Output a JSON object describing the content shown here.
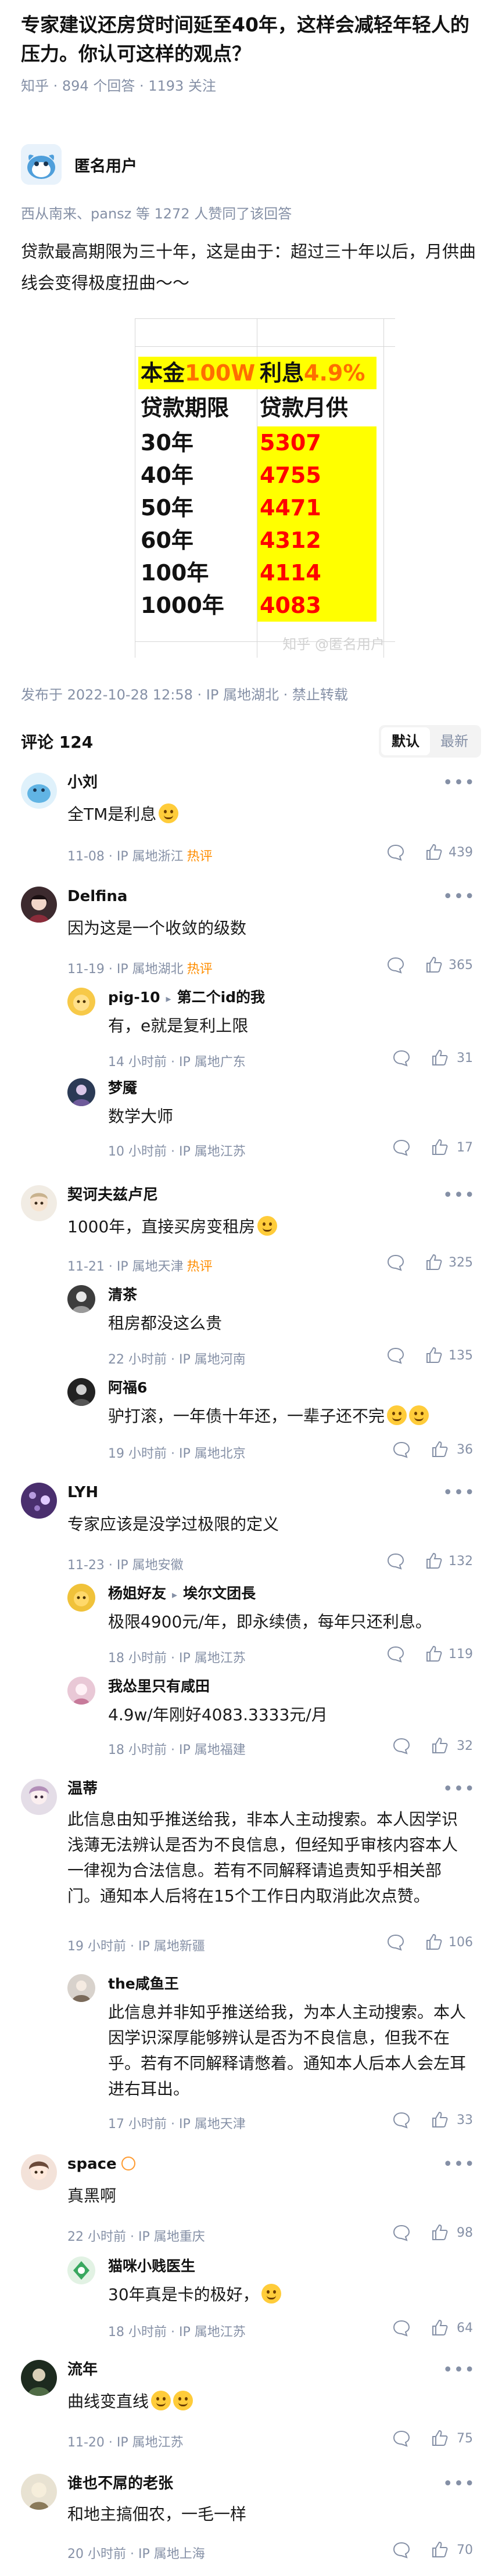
{
  "question": {
    "title": "专家建议还房贷时间延至40年，这样会减轻年轻人的压力。你认可这样的观点？",
    "meta": "知乎 · 894 个回答 · 1193 关注"
  },
  "answer": {
    "author": "匿名用户",
    "upvoters": "西从南来、pansz 等 1272 人赞同了该回答",
    "body": "贷款最高期限为三十年，这是由于：超过三十年以后，月供曲线会变得极度扭曲～～",
    "published": "发布于 2022-10-28 12:58 · IP 属地湖北 · 禁止转载"
  },
  "image_table": {
    "principal_label": "本金",
    "principal_value": "100W",
    "rate_label": "利息",
    "rate_value": "4.9%",
    "col1": "贷款期限",
    "col2": "贷款月供",
    "rows": [
      {
        "term": "30年",
        "payment": "5307"
      },
      {
        "term": "40年",
        "payment": "4755"
      },
      {
        "term": "50年",
        "payment": "4471"
      },
      {
        "term": "60年",
        "payment": "4312"
      },
      {
        "term": "100年",
        "payment": "4114"
      },
      {
        "term": "1000年",
        "payment": "4083"
      }
    ],
    "watermark": "知乎 @匿名用户"
  },
  "comments_header": {
    "title": "评论 124",
    "sort_default": "默认",
    "sort_latest": "最新"
  },
  "comments": [
    {
      "name": "小刘",
      "text": "全TM是利息",
      "time": "11-08",
      "ip": "IP 属地浙江",
      "hot": "热评",
      "likes": "439"
    },
    {
      "name": "Delfina",
      "text": "因为这是一个收敛的级数",
      "time": "11-19",
      "ip": "IP 属地湖北",
      "hot": "热评",
      "likes": "365"
    },
    {
      "name": "pig-10",
      "reply_to": "第二个id的我",
      "text": "有，e就是复利上限",
      "time": "14 小时前",
      "ip": "IP 属地广东",
      "likes": "31"
    },
    {
      "name": "梦魇",
      "text": "数学大师",
      "time": "10 小时前",
      "ip": "IP 属地江苏",
      "likes": "17"
    },
    {
      "name": "契诃夫兹卢尼",
      "text": "1000年，直接买房变租房",
      "time": "11-21",
      "ip": "IP 属地天津",
      "hot": "热评",
      "likes": "325"
    },
    {
      "name": "清茶",
      "text": "租房都没这么贵",
      "time": "22 小时前",
      "ip": "IP 属地河南",
      "likes": "135"
    },
    {
      "name": "阿福6",
      "text": "驴打滚，一年债十年还，一辈子还不完",
      "time": "19 小时前",
      "ip": "IP 属地北京",
      "likes": "36"
    },
    {
      "name": "LYH",
      "text": "专家应该是没学过极限的定义",
      "time": "11-23",
      "ip": "IP 属地安徽",
      "likes": "132"
    },
    {
      "name": "杨姐好友",
      "reply_to": "埃尔文团長",
      "text": "极限4900元/年，即永续债，每年只还利息。",
      "time": "18 小时前",
      "ip": "IP 属地江苏",
      "likes": "119"
    },
    {
      "name": "我怂里只有咸田",
      "text": "4.9w/年刚好4083.3333元/月",
      "time": "18 小时前",
      "ip": "IP 属地福建",
      "likes": "32"
    },
    {
      "name": "温蒂",
      "text": "此信息由知乎推送给我，非本人主动搜索。本人因学识浅薄无法辨认是否为不良信息，但经知乎审核内容本人一律视为合法信息。若有不同解释请追责知乎相关部门。通知本人后将在15个工作日内取消此次点赞。",
      "time": "19 小时前",
      "ip": "IP 属地新疆",
      "likes": "106"
    },
    {
      "name": "the咸鱼王",
      "text": "此信息并非知乎推送给我，为本人主动搜索。本人因学识深厚能够辨认是否为不良信息，但我不在乎。若有不同解释请憋着。通知本人后本人会左耳进右耳出。",
      "time": "17 小时前",
      "ip": "IP 属地天津",
      "likes": "33"
    },
    {
      "name": "space",
      "text": "真黑啊",
      "time": "22 小时前",
      "ip": "IP 属地重庆",
      "likes": "98"
    },
    {
      "name": "猫咪小贱医生",
      "text": "30年真是卡的极好，",
      "time": "18 小时前",
      "ip": "IP 属地江苏",
      "likes": "64"
    },
    {
      "name": "流年",
      "text": "曲线变直线",
      "time": "11-20",
      "ip": "IP 属地江苏",
      "likes": "75"
    },
    {
      "name": "谁也不屌的老张",
      "text": "和地主搞佃农，一毛一样",
      "time": "20 小时前",
      "ip": "IP 属地上海",
      "likes": "70"
    }
  ],
  "icons": {
    "more": "more-dots-icon",
    "reply": "comment-bubble-icon",
    "like": "thumb-up-icon"
  }
}
